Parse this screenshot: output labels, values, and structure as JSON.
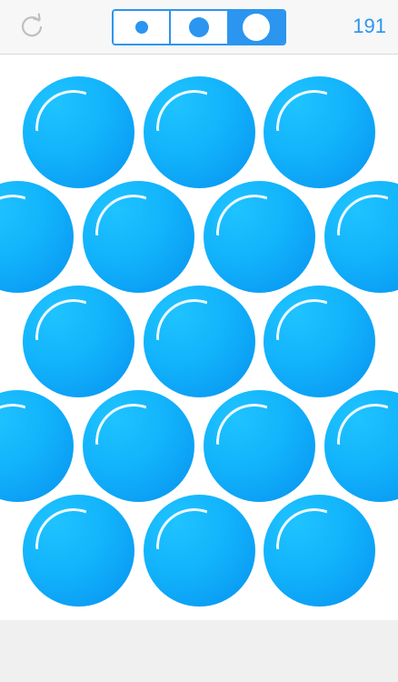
{
  "toolbar": {
    "reset_icon": "refresh-icon",
    "size_options": [
      {
        "name": "small",
        "selected": false
      },
      {
        "name": "medium",
        "selected": false
      },
      {
        "name": "large",
        "selected": true
      }
    ],
    "counter": "191"
  },
  "board": {
    "rows": 5,
    "bubbles_per_row": [
      3,
      4,
      3,
      4,
      3
    ]
  },
  "colors": {
    "accent": "#2b95f0",
    "bubble": "#12b3fb",
    "toolbar_bg": "#f7f7f7",
    "footer_bg": "#f0f0f0"
  }
}
